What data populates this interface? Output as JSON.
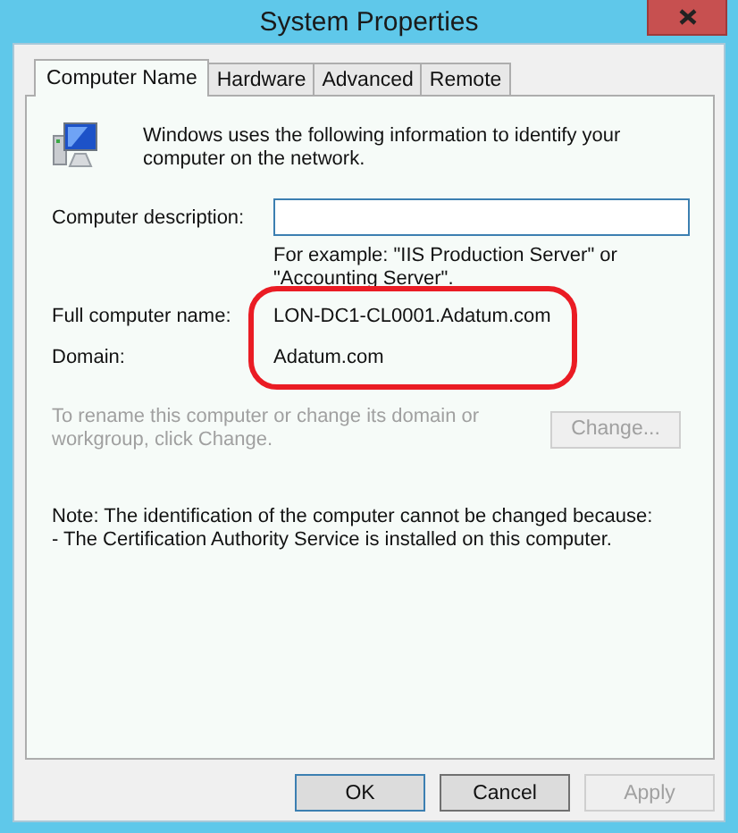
{
  "window": {
    "title": "System Properties"
  },
  "tabs": [
    {
      "label": "Computer Name",
      "selected": true
    },
    {
      "label": "Hardware",
      "selected": false
    },
    {
      "label": "Advanced",
      "selected": false
    },
    {
      "label": "Remote",
      "selected": false
    }
  ],
  "intro": "Windows uses the following information to identify your computer on the network.",
  "description": {
    "label": "Computer description:",
    "hint": "For example: \"IIS Production Server\" or \"Accounting Server\"."
  },
  "full_name": {
    "label": "Full computer name:",
    "value": "LON-DC1-CL0001.Adatum.com"
  },
  "domain": {
    "label": "Domain:",
    "value": "Adatum.com"
  },
  "highlight": {
    "kind": "ellipse",
    "color": "#ea1c24"
  },
  "rename": {
    "text": "To rename this computer or change its domain or workgroup, click Change.",
    "disabled": true
  },
  "change_button": {
    "label": "Change...",
    "disabled": true
  },
  "note": [
    "Note: The identification of the computer cannot be changed because:",
    "- The Certification Authority Service is installed on this computer."
  ],
  "buttons": [
    {
      "label": "OK",
      "default": true,
      "disabled": false
    },
    {
      "label": "Cancel",
      "default": false,
      "disabled": false
    },
    {
      "label": "Apply",
      "default": false,
      "disabled": true
    }
  ]
}
